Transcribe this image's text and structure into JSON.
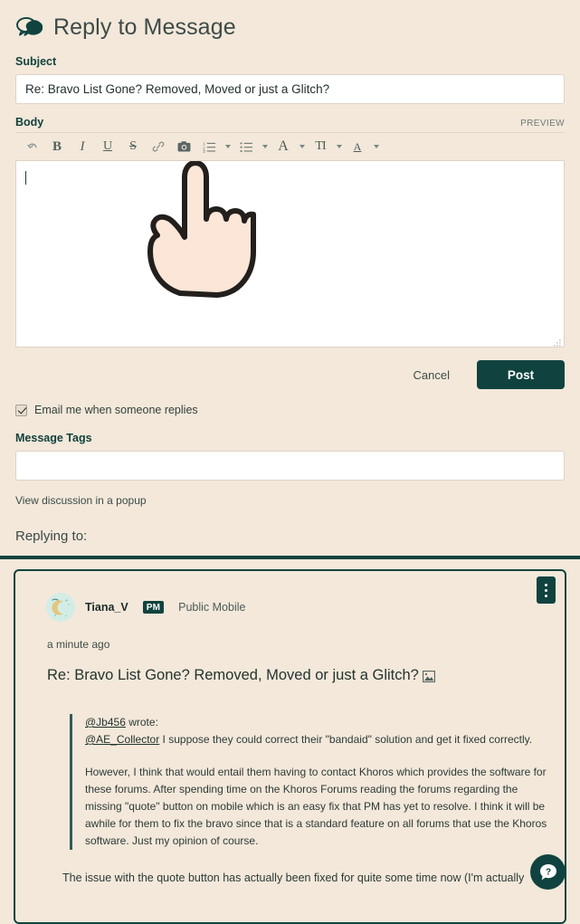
{
  "header": {
    "title": "Reply to Message",
    "icon": "speech-bubbles-icon"
  },
  "form": {
    "subject_label": "Subject",
    "subject_value": "Re: Bravo List Gone? Removed, Moved or just a Glitch?",
    "subject_placeholder": "",
    "body_label": "Body",
    "preview_label": "PREVIEW",
    "body_value": "",
    "body_placeholder": ""
  },
  "toolbar": {
    "buttons": [
      {
        "name": "undo-icon",
        "label": "undo"
      },
      {
        "name": "bold-icon",
        "label": "B"
      },
      {
        "name": "italic-icon",
        "label": "I"
      },
      {
        "name": "underline-icon",
        "label": "U"
      },
      {
        "name": "strikethrough-icon",
        "label": "S"
      },
      {
        "name": "link-icon",
        "label": "link"
      },
      {
        "name": "camera-icon",
        "label": "image"
      },
      {
        "name": "numbered-list-icon",
        "label": "ordered list"
      },
      {
        "name": "bulleted-list-icon",
        "label": "bulleted list"
      },
      {
        "name": "font-color-icon",
        "label": "A"
      },
      {
        "name": "text-size-icon",
        "label": "TI"
      },
      {
        "name": "highlight-icon",
        "label": "A"
      }
    ]
  },
  "actions": {
    "cancel_label": "Cancel",
    "post_label": "Post"
  },
  "options": {
    "email_checkbox_label": "Email me when someone replies",
    "email_checkbox_checked": true,
    "message_tags_label": "Message Tags",
    "message_tags_value": "",
    "message_tags_placeholder": "",
    "popup_link_label": "View discussion in a popup"
  },
  "replying": {
    "heading": "Replying to:"
  },
  "post": {
    "author": "Tiana_V",
    "rank_badge": "PM",
    "rank_text": "Public Mobile",
    "timestamp": "a minute ago",
    "title": "Re: Bravo List Gone? Removed, Moved or just a Glitch?",
    "quote_author": "@Jb456",
    "quote_author_suffix": " wrote:",
    "quote_mention": "@AE_Collector",
    "quote_first_line": "  I suppose they could correct their \"bandaid\" solution and get it fixed correctly.",
    "quote_paragraph": "However, I think that would entail them having to contact Khoros which provides the software for these forums. After spending time on the Khoros Forums reading the forums regarding the missing \"quote\" button on mobile which is an easy fix that PM has yet to resolve. I think it will be awhile for them to fix the bravo since that is a standard feature on all forums that use the Khoros software. Just my opinion of course.",
    "tail_text": "The issue with the quote button has actually been fixed for quite some time now (I'm actually"
  },
  "help": {
    "label": "?"
  },
  "colors": {
    "page_background": "#F3E8DA",
    "accent_dark_teal": "#10433F",
    "input_background": "#FFFFFF",
    "avatar_background": "#D3EDE6"
  }
}
